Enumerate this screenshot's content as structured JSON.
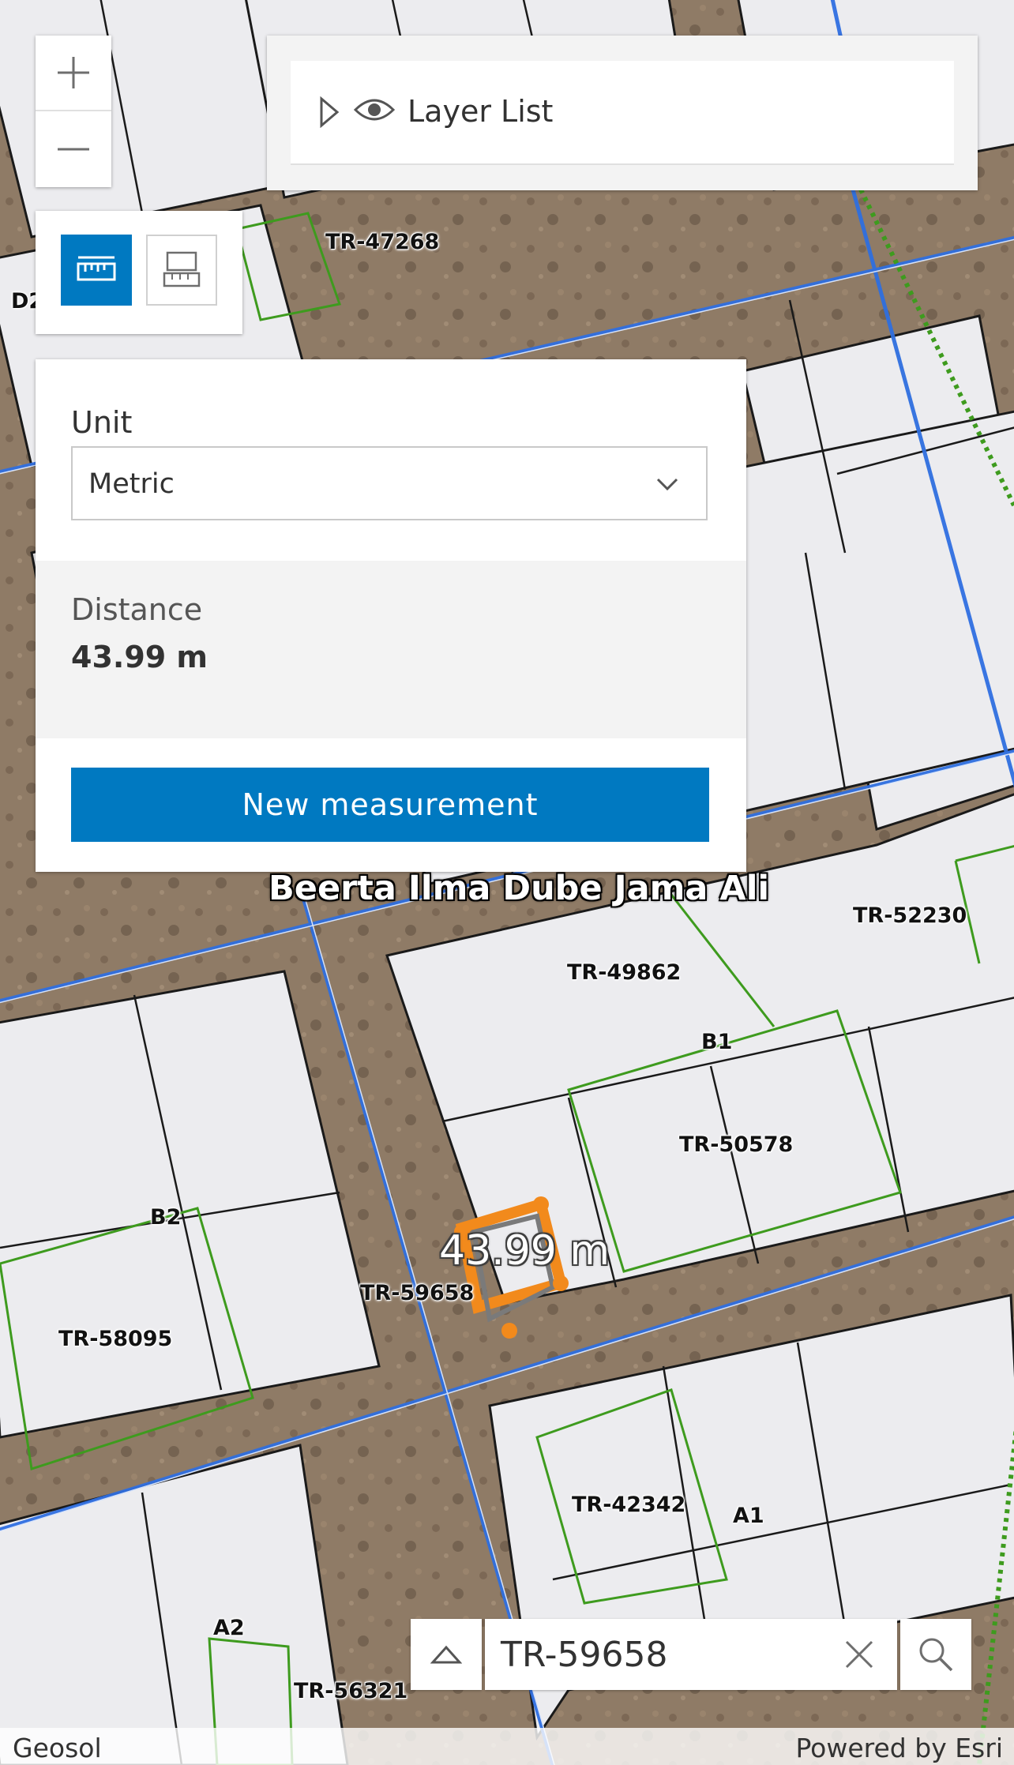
{
  "map": {
    "parcel_labels": [
      "TR-47268",
      "D2",
      "TR-52230",
      "TR-49862",
      "B1",
      "TR-50578",
      "B2",
      "TR-59658",
      "TR-58095",
      "TR-42342",
      "A1",
      "A2",
      "TR-56321"
    ],
    "place_label": "Beerta Ilma Dube Jama Ali",
    "measurement_label": "43.99 m",
    "colors": {
      "ground": "#8f7b66",
      "parcel_fill": "#ececef",
      "parcel_outline": "#1a1a1a",
      "green_outline": "#3e9b1e",
      "road_blue": "#2f6fe0",
      "measure_orange": "#f28a1c"
    }
  },
  "zoom": {
    "in_icon": "plus-icon",
    "out_icon": "minus-icon"
  },
  "layer_list": {
    "expand_icon": "triangle-right-icon",
    "visibility_icon": "eye-icon",
    "title": "Layer List"
  },
  "measure_tools": {
    "distance_icon": "ruler-icon",
    "area_icon": "area-measure-icon",
    "active_color": "#0079c1"
  },
  "measurement": {
    "unit_label": "Unit",
    "unit_value": "Metric",
    "dropdown_icon": "chevron-down-icon",
    "distance_label": "Distance",
    "distance_value": "43.99 m",
    "new_button": "New measurement"
  },
  "search": {
    "expand_icon": "triangle-up-icon",
    "value": "TR-59658",
    "clear_icon": "close-icon",
    "search_icon": "search-icon"
  },
  "attribution": {
    "left": "Geosol",
    "right": "Powered by Esri"
  }
}
